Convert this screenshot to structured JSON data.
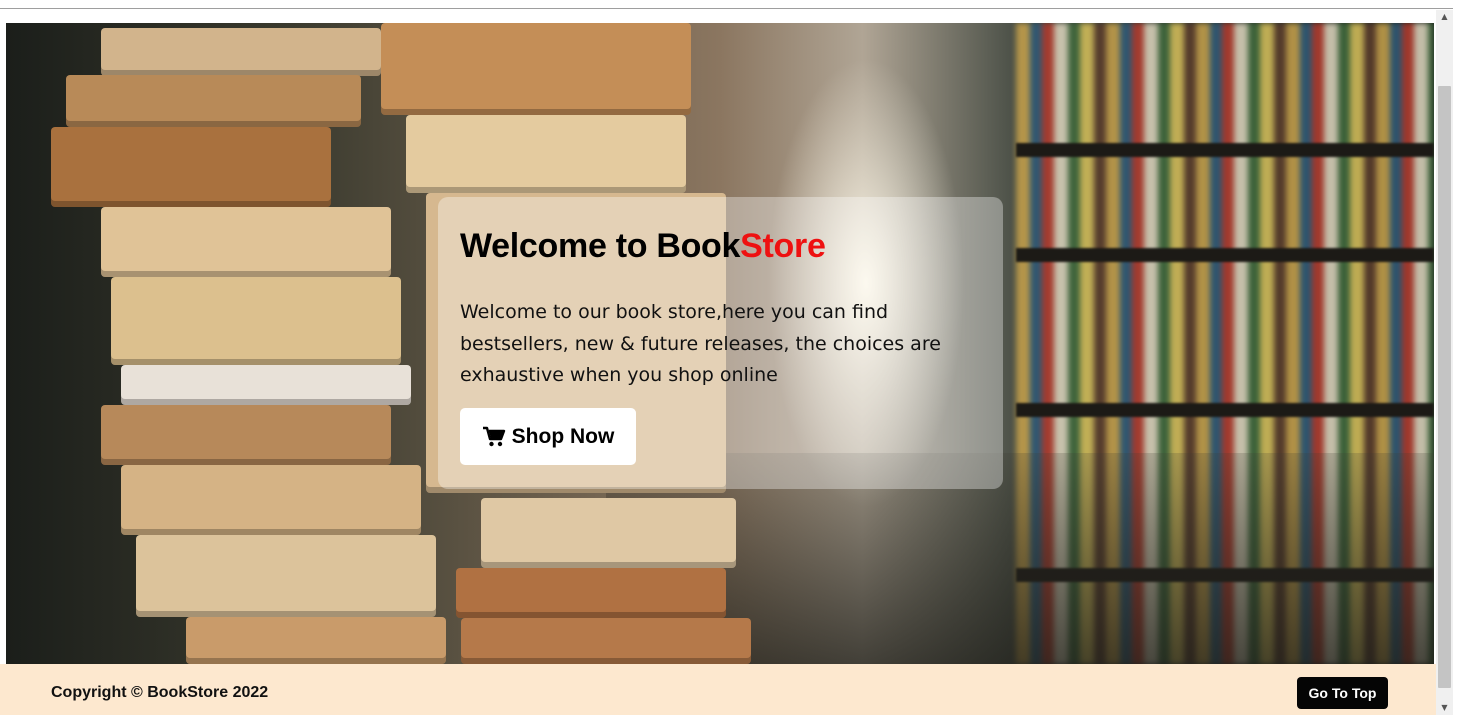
{
  "hero": {
    "title_main": "Welcome to Book",
    "title_accent": "Store",
    "description": "Welcome to our book store,here you can find bestsellers, new & future releases, the choices are exhaustive when you shop online",
    "cta_label": "Shop Now",
    "cta_icon": "shopping-cart-icon",
    "accent_color": "#ee1111"
  },
  "footer": {
    "copyright": "Copyright © BookStore 2022",
    "top_button_label": "Go To Top",
    "background_color": "#fde8cf"
  },
  "scrollbar": {
    "up_arrow": "▲",
    "down_arrow": "▼"
  }
}
